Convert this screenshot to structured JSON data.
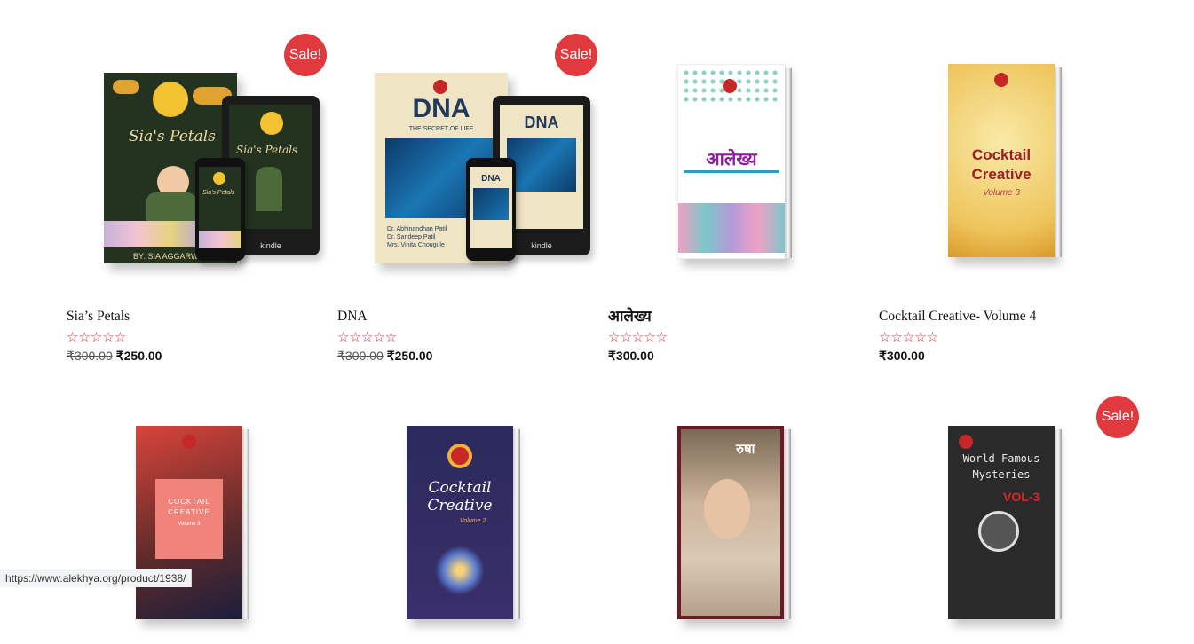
{
  "products": [
    {
      "title": "Sia’s Petals",
      "old_price": "₹300.00",
      "price": "₹250.00",
      "sale": "Sale!",
      "stars": "☆☆☆☆☆",
      "cover_title": "Sia's Petals",
      "cover_author": "BY: SIA AGGARWAL",
      "device_label": "kindle"
    },
    {
      "title": "DNA",
      "old_price": "₹300.00",
      "price": "₹250.00",
      "sale": "Sale!",
      "stars": "☆☆☆☆☆",
      "cover_title": "DNA",
      "cover_subtitle": "THE SECRET OF LIFE",
      "device_label": "kindle"
    },
    {
      "title": "आलेख्य",
      "price": "₹300.00",
      "stars": "☆☆☆☆☆",
      "cover_title": "आलेख्य"
    },
    {
      "title": "Cocktail Creative- Volume 4",
      "price": "₹300.00",
      "stars": "☆☆☆☆☆",
      "cover_title": "Cocktail Creative",
      "cover_volume": "Volume 3"
    },
    {
      "cover_title": "COCKTAIL CREATIVE",
      "cover_volume": "Volume 3"
    },
    {
      "cover_title": "Cocktail Creative",
      "cover_volume": "Volume 2"
    },
    {
      "cover_title": "रुषा"
    },
    {
      "cover_title": "World Famous Mysteries",
      "cover_volume": "VOL-3",
      "sale": "Sale!"
    }
  ],
  "status_url": "https://www.alekhya.org/product/1938/",
  "colors": {
    "sale_badge": "#e03a3e",
    "star": "#cf2e2e"
  }
}
